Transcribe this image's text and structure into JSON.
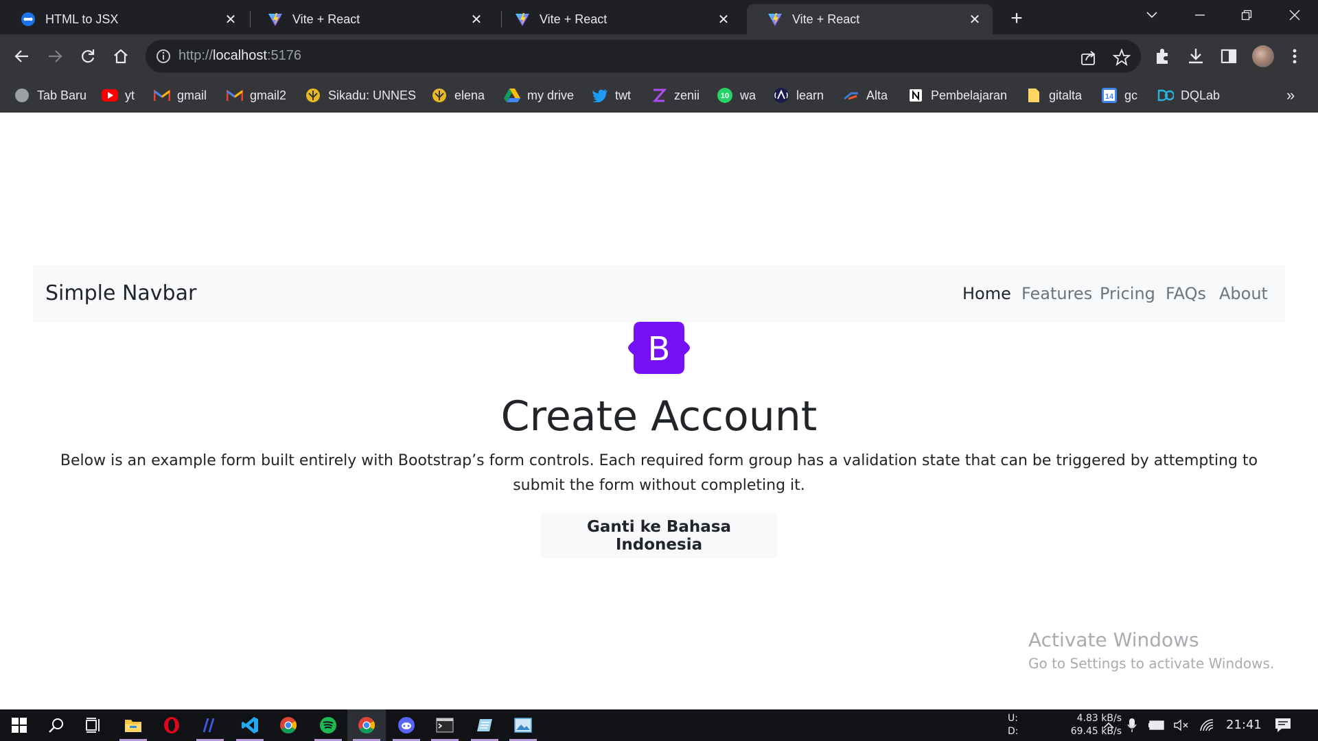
{
  "browser": {
    "tabs": [
      {
        "title": "HTML to JSX",
        "icon": "html-to-jsx-icon",
        "active": false
      },
      {
        "title": "Vite + React",
        "icon": "vite-icon",
        "active": false
      },
      {
        "title": "Vite + React",
        "icon": "vite-icon",
        "active": false
      },
      {
        "title": "Vite + React",
        "icon": "vite-icon",
        "active": true
      }
    ],
    "address": {
      "scheme": "http://",
      "host": "localhost",
      "port": ":5176"
    },
    "bookmarks": [
      {
        "label": "Tab Baru",
        "icon": "globe-icon"
      },
      {
        "label": "yt",
        "icon": "youtube-icon"
      },
      {
        "label": "gmail",
        "icon": "gmail-icon"
      },
      {
        "label": "gmail2",
        "icon": "gmail-icon"
      },
      {
        "label": "Sikadu: UNNES",
        "icon": "unnes-icon"
      },
      {
        "label": "elena",
        "icon": "unnes-icon"
      },
      {
        "label": "my drive",
        "icon": "drive-icon"
      },
      {
        "label": "twt",
        "icon": "twitter-icon"
      },
      {
        "label": "zenii",
        "icon": "zenius-icon"
      },
      {
        "label": "wa",
        "icon": "whatsapp-icon"
      },
      {
        "label": "learn",
        "icon": "learn-icon"
      },
      {
        "label": "Alta",
        "icon": "alta-icon"
      },
      {
        "label": "Pembelajaran",
        "icon": "notion-icon"
      },
      {
        "label": "gitalta",
        "icon": "folder-icon"
      },
      {
        "label": "gc",
        "icon": "calendar-icon"
      },
      {
        "label": "DQLab",
        "icon": "dqlab-icon"
      }
    ],
    "calendar_day": "14",
    "wa_badge": "10",
    "more_bookmarks": "»"
  },
  "page": {
    "brand": "Simple Navbar",
    "nav": [
      "Home",
      "Features",
      "Pricing",
      "FAQs",
      "About"
    ],
    "logo_letter": "B",
    "heading": "Create Account",
    "lead": "Below is an example form built entirely with Bootstrap’s form controls. Each required form group has a validation state that can be triggered by attempting to submit the form without completing it.",
    "button": "Ganti ke Bahasa Indonesia",
    "brand_color": "#7611f7"
  },
  "watermark": {
    "title": "Activate Windows",
    "subtitle": "Go to Settings to activate Windows."
  },
  "taskbar": {
    "network": {
      "up_label": "U:",
      "up_value": "4.83 kB/s",
      "down_label": "D:",
      "down_value": "69.45 kB/s"
    },
    "clock": "21:41"
  }
}
